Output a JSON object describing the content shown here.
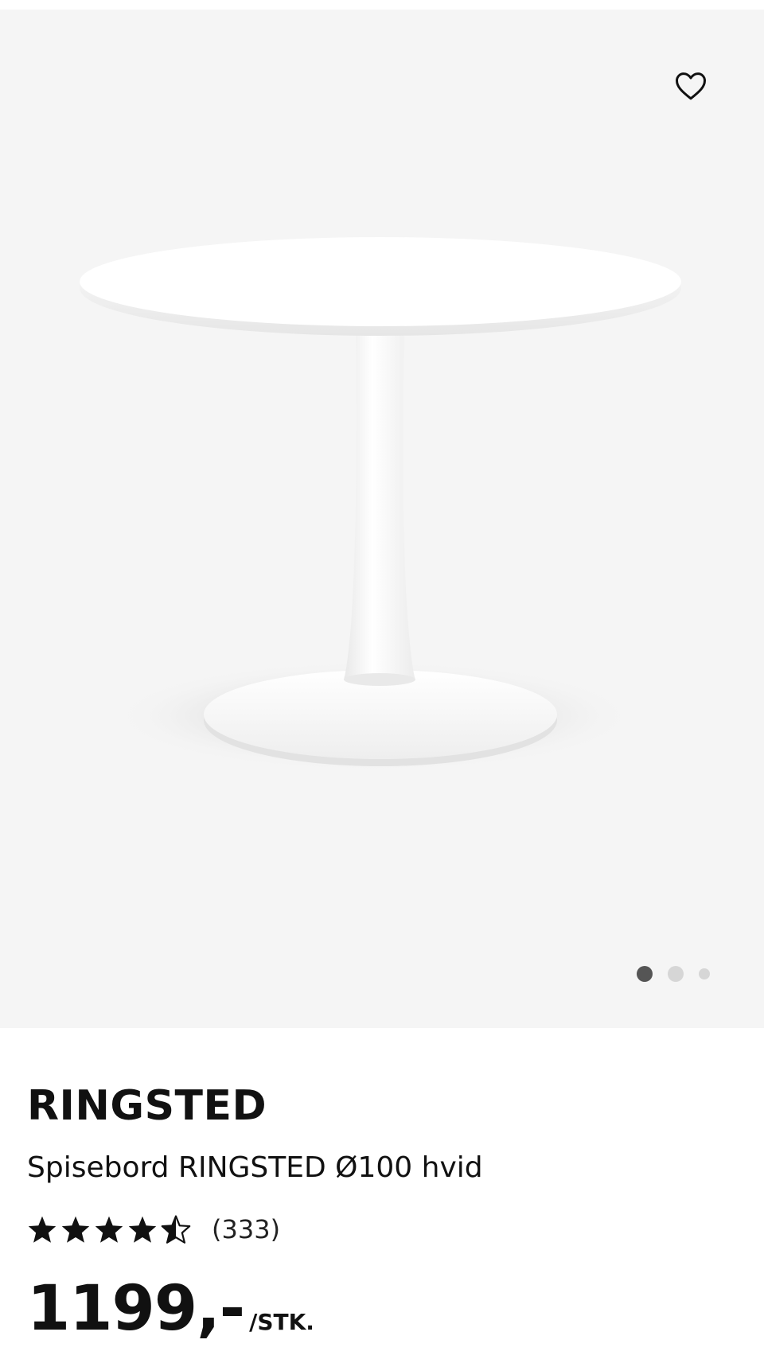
{
  "icons": {
    "favorite": "heart-outline-icon",
    "rating_star": "star-icon",
    "rating_half_star": "star-half-icon"
  },
  "gallery": {
    "image_count": 3,
    "active_index": 0
  },
  "product": {
    "name": "RINGSTED",
    "description": "Spisebord RINGSTED Ø100 hvid",
    "rating": 4.5,
    "rating_max": 5,
    "review_count": "(333)",
    "price": "1199,-",
    "price_unit": "/STK."
  },
  "colors": {
    "gallery_background": "#f5f5f5",
    "text": "#111111",
    "dot_active": "#555555",
    "dot_inactive": "#d6d6d6"
  }
}
